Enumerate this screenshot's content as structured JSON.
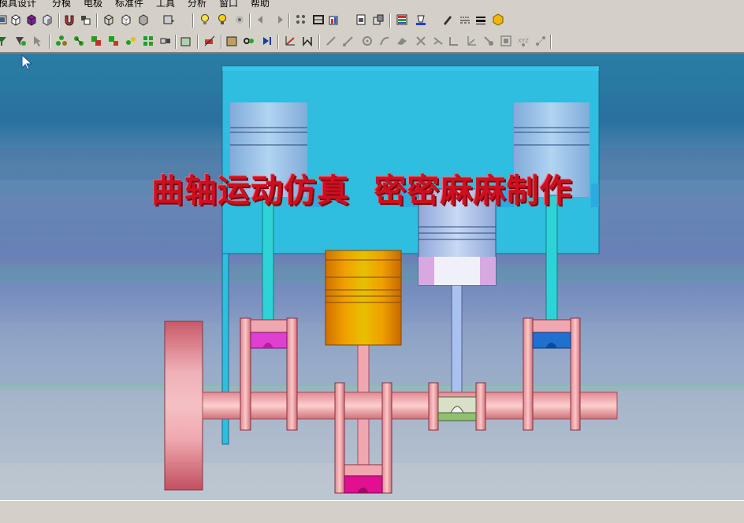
{
  "menu": {
    "items": [
      "模具设计",
      "分模",
      "电极",
      "标准件",
      "工具",
      "分析",
      "窗口",
      "帮助"
    ]
  },
  "toolbar1": {
    "icons": [
      "face-select-icon",
      "cube-icon",
      "cube-purple-icon",
      "shaded-cube-icon",
      "magnet-icon",
      "component-icon",
      "wireframe-cube-icon",
      "hidden-cube-icon",
      "shaded-solid-icon",
      "view-dropdown-icon",
      "lightbulb-icon",
      "light-icon",
      "eye-icon",
      "back-arrow-icon",
      "forward-arrow-icon",
      "grid-dots-icon",
      "measure-icon",
      "chart-icon",
      "sketch-icon",
      "parts-icon",
      "color-grid-icon",
      "paint-bucket-icon",
      "pencil-icon",
      "line-style-icon",
      "line-weight-icon",
      "hexagon-icon"
    ]
  },
  "toolbar2": {
    "icons": [
      "select-filter-icon",
      "sub-select-icon",
      "select-arrow-icon",
      "tree-icon",
      "assembly-icon",
      "mate-icon",
      "add-part-icon",
      "group-icon",
      "array-icon",
      "box-icon",
      "delete-icon",
      "transform-icon",
      "play-icon",
      "axis-icon",
      "trim-icon",
      "line-icon",
      "slash-icon",
      "circle-icon",
      "curve-icon",
      "spline-icon",
      "cross-icon",
      "fillet-icon",
      "bend-icon",
      "axis-3d-icon",
      "point-icon",
      "frame-icon",
      "xyz-icon",
      "coordinates-icon"
    ]
  },
  "viewport": {
    "title": "曲轴运动仿真  密密麻麻制作",
    "colors": {
      "engine_block": "#2fbde0",
      "piston_orange": "#e09000",
      "piston_light": "#b6ccee",
      "rod_cyan": "#2ed3d7",
      "crank_pink": "#f0a8a8",
      "flywheel": "#e06e78",
      "bearing_magenta": "#e040d0",
      "bearing_blue": "#2070d0",
      "bearing_hotpink": "#e01090"
    }
  }
}
